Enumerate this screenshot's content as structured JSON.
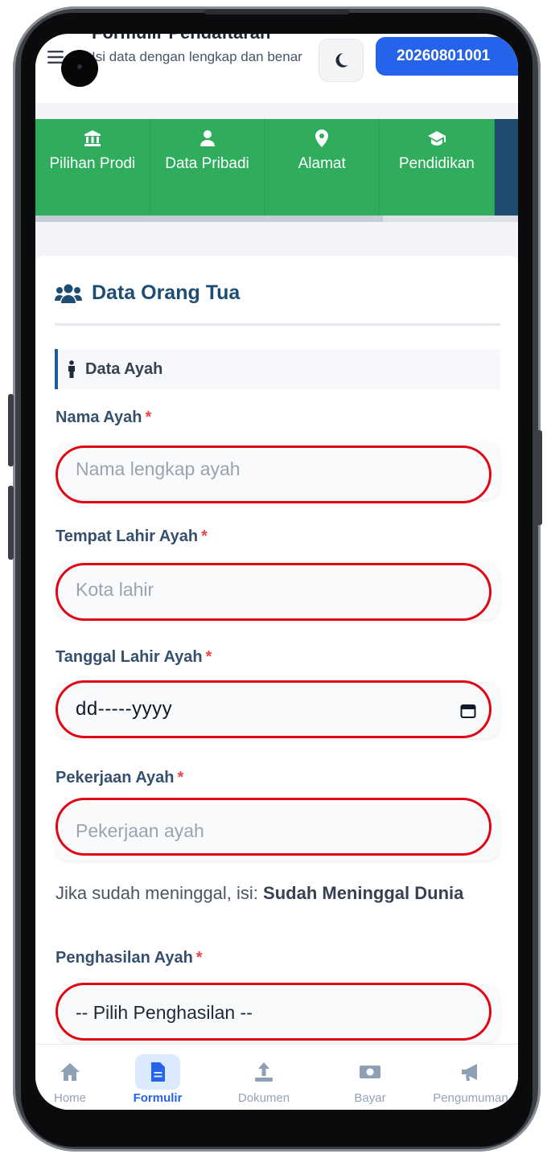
{
  "header": {
    "title": "Formulir Pendaftaran",
    "subtitle": "Isi data dengan lengkap dan benar",
    "registration_number": "20260801001",
    "theme_icon": "moon-icon",
    "menu_icon": "hamburger-menu-icon"
  },
  "steps": [
    {
      "label": "Pilihan Prodi",
      "icon": "university-icon"
    },
    {
      "label": "Data Pribadi",
      "icon": "user-icon"
    },
    {
      "label": "Alamat",
      "icon": "map-marker-icon"
    },
    {
      "label": "Pendidikan",
      "icon": "graduation-cap-icon"
    }
  ],
  "section": {
    "title": "Data Orang Tua",
    "icon": "users-icon",
    "subsection_title": "Data Ayah",
    "subsection_icon": "male-person-icon"
  },
  "form": {
    "required_mark": "*",
    "nama_ayah": {
      "label": "Nama Ayah",
      "placeholder": "Nama lengkap ayah"
    },
    "tempat_lahir": {
      "label": "Tempat Lahir Ayah",
      "placeholder": "Kota lahir"
    },
    "tanggal_lahir": {
      "label": "Tanggal Lahir Ayah",
      "value": "dd-----yyyy"
    },
    "pekerjaan": {
      "label": "Pekerjaan Ayah",
      "placeholder": "Pekerjaan ayah"
    },
    "hint": {
      "prefix": "Jika sudah meninggal, isi: ",
      "emphasis": "Sudah Meninggal Dunia"
    },
    "penghasilan": {
      "label": "Penghasilan Ayah",
      "selected": "-- Pilih Penghasilan --"
    }
  },
  "bottom_nav": [
    {
      "label": "Home",
      "icon": "home-icon",
      "active": false
    },
    {
      "label": "Formulir",
      "icon": "file-icon",
      "active": true
    },
    {
      "label": "Dokumen",
      "icon": "upload-icon",
      "active": false
    },
    {
      "label": "Bayar",
      "icon": "money-bill-icon",
      "active": false
    },
    {
      "label": "Pengumuman",
      "icon": "megaphone-icon",
      "active": false
    }
  ],
  "colors": {
    "primary": "#2563eb",
    "steps_bg": "#2fac5c",
    "heading": "#1e4d74",
    "highlight_ring": "#e10613",
    "required": "#ef4444"
  }
}
